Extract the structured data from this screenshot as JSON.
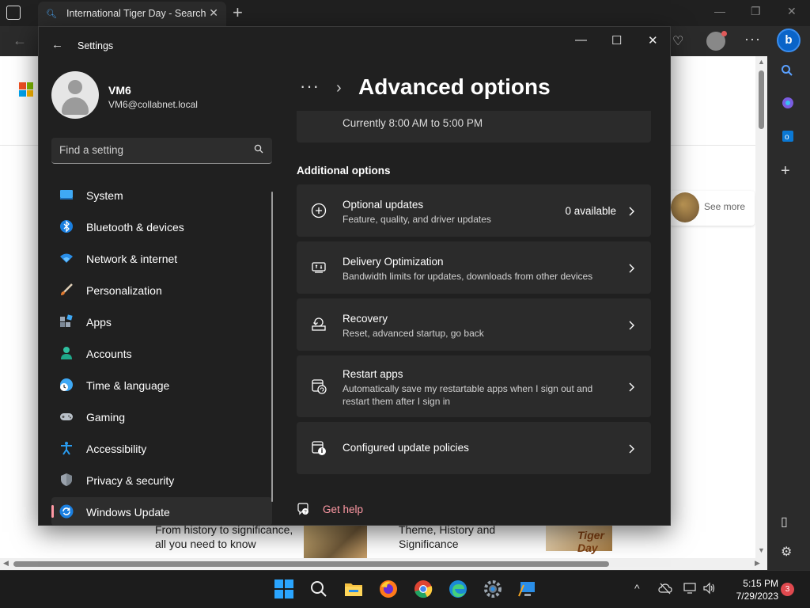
{
  "browser": {
    "tab_title": "International Tiger Day - Search",
    "see_more": "See more",
    "card1_line1": "From history to significance,",
    "card1_line2": "all you need to know",
    "card2_line1": "Theme, History and",
    "card2_line2": "Significance",
    "tiger_logo_text": "Tiger Day"
  },
  "settings": {
    "app_title": "Settings",
    "user": {
      "name": "VM6",
      "email": "VM6@collabnet.local"
    },
    "search": {
      "placeholder": "Find a setting"
    },
    "nav": [
      {
        "label": "System",
        "icon": "system-icon"
      },
      {
        "label": "Bluetooth & devices",
        "icon": "bluetooth-icon"
      },
      {
        "label": "Network & internet",
        "icon": "wifi-icon"
      },
      {
        "label": "Personalization",
        "icon": "brush-icon"
      },
      {
        "label": "Apps",
        "icon": "apps-icon"
      },
      {
        "label": "Accounts",
        "icon": "accounts-icon"
      },
      {
        "label": "Time & language",
        "icon": "globe-clock-icon"
      },
      {
        "label": "Gaming",
        "icon": "gamepad-icon"
      },
      {
        "label": "Accessibility",
        "icon": "accessibility-icon"
      },
      {
        "label": "Privacy & security",
        "icon": "shield-icon"
      },
      {
        "label": "Windows Update",
        "icon": "update-icon",
        "active": true
      }
    ],
    "page_title": "Advanced options",
    "active_hours_text": "Currently 8:00 AM to 5:00 PM",
    "section_title": "Additional options",
    "options": [
      {
        "title": "Optional updates",
        "subtitle": "Feature, quality, and driver updates",
        "count": "0 available",
        "icon": "plus-circle-icon"
      },
      {
        "title": "Delivery Optimization",
        "subtitle": "Bandwidth limits for updates, downloads from other devices",
        "icon": "delivery-optimization-icon"
      },
      {
        "title": "Recovery",
        "subtitle": "Reset, advanced startup, go back",
        "icon": "recovery-icon"
      },
      {
        "title": "Restart apps",
        "subtitle": "Automatically save my restartable apps when I sign out and restart them after I sign in",
        "icon": "restart-apps-icon"
      },
      {
        "title": "Configured update policies",
        "subtitle": "",
        "icon": "policy-icon"
      }
    ],
    "help_label": "Get help"
  },
  "taskbar": {
    "time": "5:15 PM",
    "date": "7/29/2023",
    "notification_count": "3"
  },
  "colors": {
    "accent_pink": "#ff99a4",
    "window_bg": "#202020",
    "card_bg": "#2b2b2b"
  }
}
